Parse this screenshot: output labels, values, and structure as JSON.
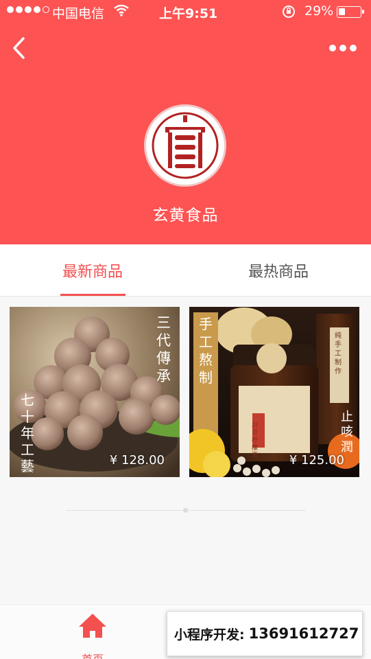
{
  "status_bar": {
    "carrier": "中国电信",
    "time": "上午9:51",
    "battery": "29%"
  },
  "header": {
    "shop_name": "玄黄食品",
    "background_color": "#fd5353"
  },
  "tabs": [
    {
      "label": "最新商品",
      "active": true
    },
    {
      "label": "最热商品",
      "active": false
    }
  ],
  "products": [
    {
      "price": "¥ 128.00",
      "image_text": [
        "三代傳承",
        "七十年工藝"
      ]
    },
    {
      "price": "¥ 125.00",
      "image_text": [
        "手工熬制",
        "川贝柠檬膏",
        "止咳潤",
        "纯手工制作"
      ]
    }
  ],
  "bottom_nav": {
    "home_label": "首页"
  },
  "promo": {
    "label": "小程序开发:",
    "phone": "13691612727"
  },
  "accent_color": "#f35050"
}
